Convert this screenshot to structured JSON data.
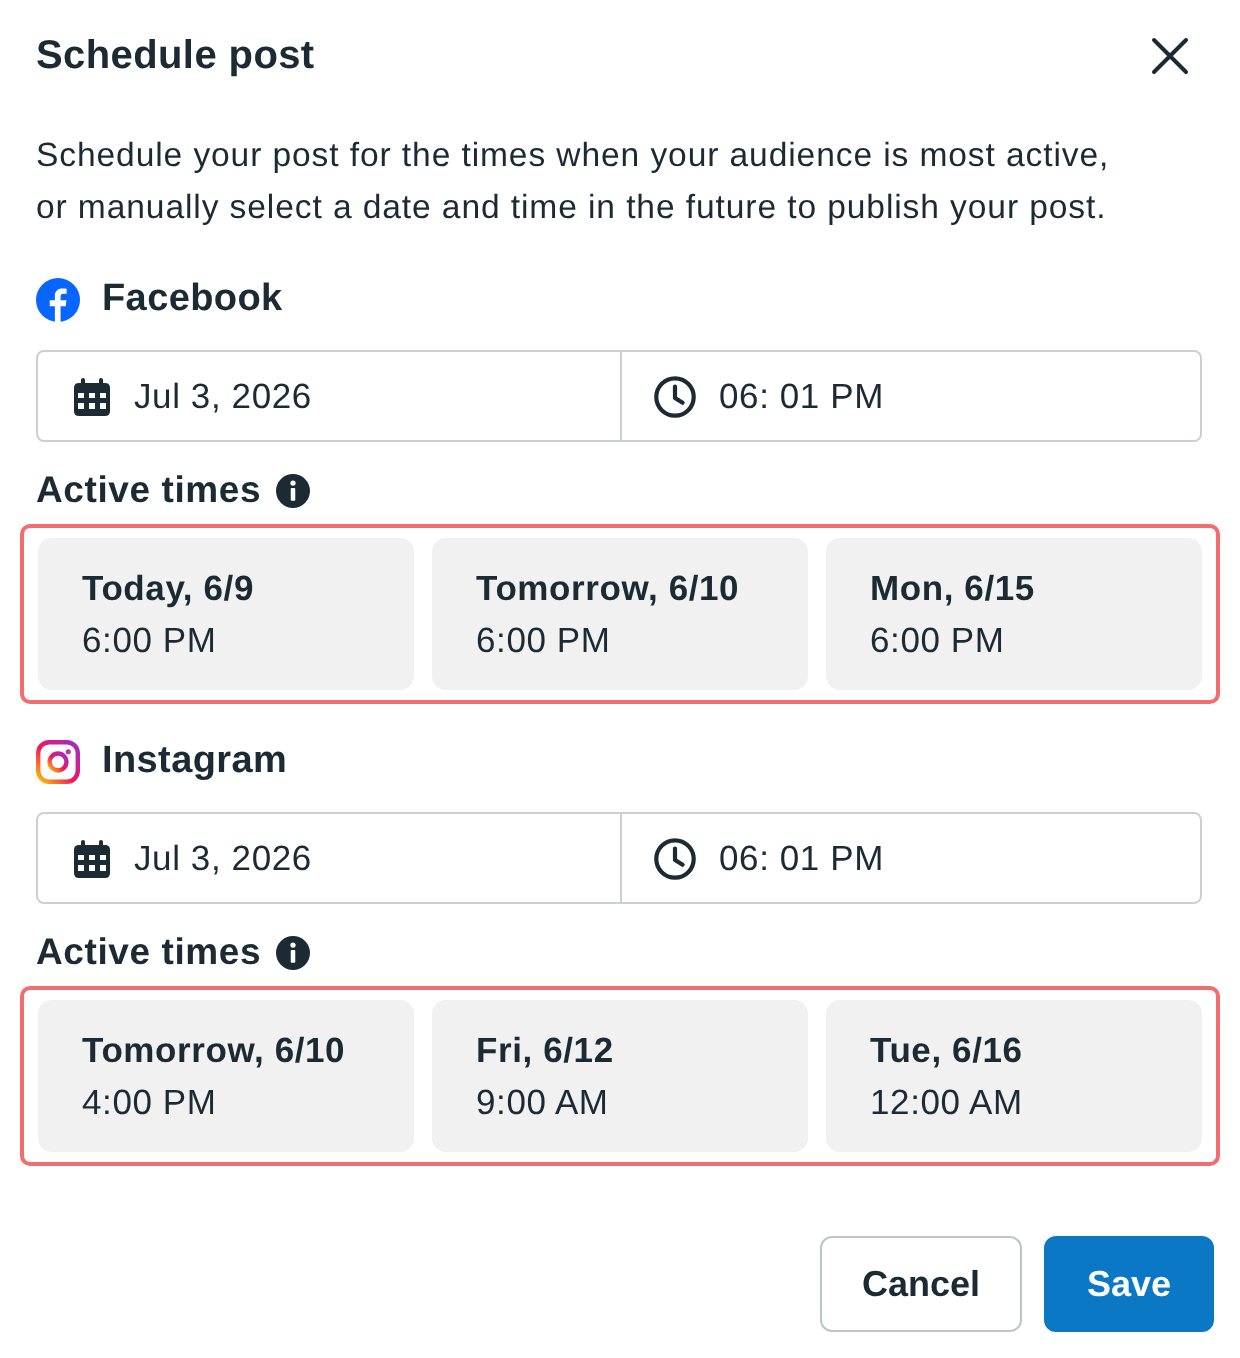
{
  "dialog": {
    "title": "Schedule post",
    "description_lines": [
      "Schedule your post for the times when your audience is most active,",
      "or manually select a date and time in the future to publish your post."
    ]
  },
  "platforms": [
    {
      "kind": "facebook",
      "name": "Facebook",
      "date": "Jul 3, 2026",
      "time": "06: 01 PM",
      "active_times_label": "Active times",
      "highlighted": true,
      "active_times": [
        {
          "day": "Today, 6/9",
          "time": "6:00 PM",
          "selected": false
        },
        {
          "day": "Tomorrow, 6/10",
          "time": "6:00 PM",
          "selected": false
        },
        {
          "day": "Mon, 6/15",
          "time": "6:00 PM",
          "selected": false
        }
      ]
    },
    {
      "kind": "instagram",
      "name": "Instagram",
      "date": "Jul 3, 2026",
      "time": "06: 01 PM",
      "active_times_label": "Active times",
      "highlighted": true,
      "active_times": [
        {
          "day": "Tomorrow, 6/10",
          "time": "4:00 PM",
          "selected": false
        },
        {
          "day": "Fri, 6/12",
          "time": "9:00 AM",
          "selected": false
        },
        {
          "day": "Tue, 6/16",
          "time": "12:00 AM",
          "selected": false
        }
      ]
    }
  ],
  "buttons": [
    {
      "kind": "secondary",
      "label": "Cancel"
    },
    {
      "kind": "primary",
      "label": "Save"
    }
  ]
}
